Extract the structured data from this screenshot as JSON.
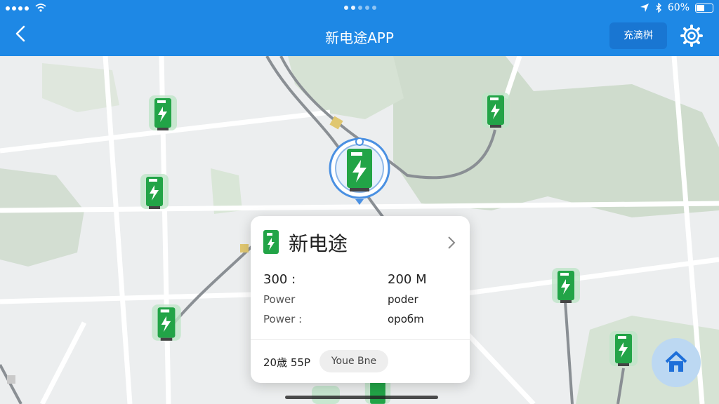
{
  "status": {
    "battery": "60%"
  },
  "header": {
    "title": "新电途APP",
    "action_label": "充滴桝"
  },
  "card": {
    "title": "新电途",
    "left_value": "300 :",
    "left_line1": "Power",
    "left_line2": "Power :",
    "right_value": "200 M",
    "right_line1": "poder",
    "right_line2": "opoбm",
    "footer_text": "20歳 55P",
    "pill_label": "Youe Bne"
  },
  "colors": {
    "header": "#1e88e5",
    "pin_green": "#22a447",
    "map_bg": "#eceeef",
    "park": "#cfe2cf",
    "road": "#ffffff"
  },
  "icons": [
    "back-arrow-icon",
    "settings-gear-icon",
    "charging-station-icon",
    "chevron-right-icon",
    "home-icon",
    "location-arrow-icon",
    "bluetooth-icon",
    "wifi-icon"
  ]
}
